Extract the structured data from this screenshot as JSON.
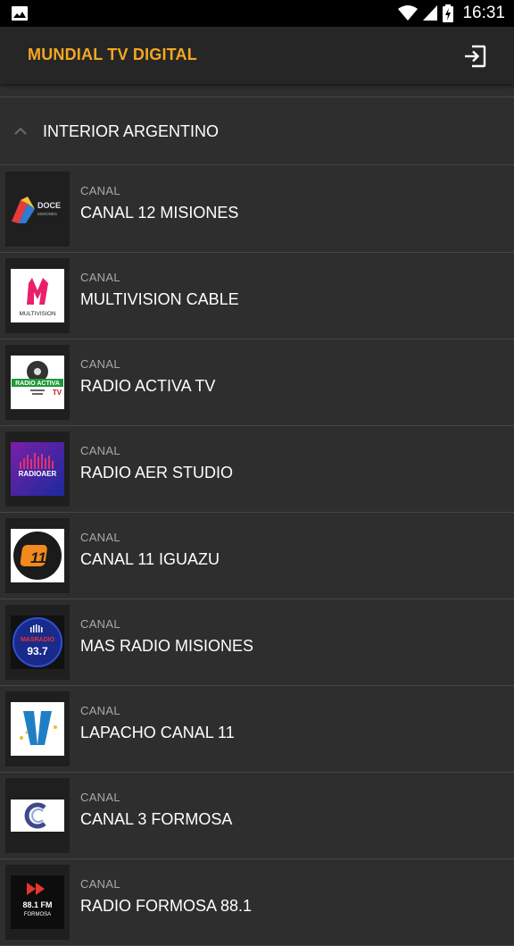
{
  "status_bar": {
    "time": "16:31",
    "icons": [
      "gallery-icon",
      "wifi-icon",
      "signal-icon",
      "battery-charging-icon"
    ]
  },
  "app_bar": {
    "title": "MUNDIAL TV DIGITAL",
    "action_icon": "logout-icon",
    "title_color": "#f5a623"
  },
  "section": {
    "label": "INTERIOR ARGENTINO",
    "icon": "chevron-up-icon"
  },
  "channels": [
    {
      "type": "CANAL",
      "name": "CANAL 12 MISIONES",
      "logo": "doce-misiones-logo"
    },
    {
      "type": "CANAL",
      "name": "MULTIVISION CABLE",
      "logo": "multivision-logo"
    },
    {
      "type": "CANAL",
      "name": "RADIO ACTIVA TV",
      "logo": "radio-activa-logo"
    },
    {
      "type": "CANAL",
      "name": "RADIO AER STUDIO",
      "logo": "radioaer-logo"
    },
    {
      "type": "CANAL",
      "name": "CANAL 11 IGUAZU",
      "logo": "canal-11-logo"
    },
    {
      "type": "CANAL",
      "name": "MAS RADIO MISIONES",
      "logo": "mas-radio-logo"
    },
    {
      "type": "CANAL",
      "name": "LAPACHO CANAL 11",
      "logo": "lapacho-logo"
    },
    {
      "type": "CANAL",
      "name": "CANAL 3 FORMOSA",
      "logo": "canal-3-logo"
    },
    {
      "type": "CANAL",
      "name": "RADIO FORMOSA 88.1",
      "logo": "radio-formosa-logo"
    }
  ],
  "logo_text": {
    "doce": "DOCE",
    "doce_sub": "MISIONES",
    "multivision": "MULTIVISION",
    "radio_activa": "RADIO ACTIVA",
    "radio_activa_tv": "TV",
    "radioaer": "RADIOAER",
    "canal11": "11",
    "masradio": "MASRADIO",
    "masradio_freq": "93.7",
    "radio_formosa": "88.1 FM",
    "radio_formosa_sub": "FORMOSA"
  }
}
